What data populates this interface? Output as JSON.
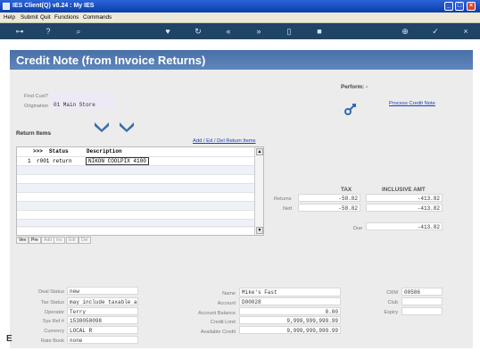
{
  "window": {
    "title": "IES Client(Q) v8.24 : My IES"
  },
  "menu": [
    "Help",
    "Submit",
    "Quit",
    "Functions",
    "Commands"
  ],
  "toolbar_icons": [
    "key-icon",
    "help-icon",
    "search-icon",
    "heart-icon",
    "refresh-icon",
    "rewind-icon",
    "forward-icon",
    "save-icon",
    "stop-icon",
    "plus-icon",
    "check-icon",
    "close-icon"
  ],
  "page": {
    "title": "Credit Note (from Invoice Returns)"
  },
  "find_cust": {
    "label": "Find Cust?",
    "value": ""
  },
  "origination": {
    "label": "Origination",
    "value": "01 Main Store"
  },
  "perform": {
    "label": "Perform: -",
    "link": "Process Credit Note"
  },
  "return_items": {
    "label": "Return Items",
    "link": "Add / Ed / Del Return Items",
    "columns": [
      ">>>",
      "Status",
      "Description"
    ],
    "rows": [
      {
        "num": "1",
        "status": "r001 return",
        "desc": "NIKON COOLPIX 4100"
      }
    ],
    "buttons": [
      "Vev",
      "Pre",
      "Add",
      "Ins",
      "Edt",
      "Del"
    ]
  },
  "totals": {
    "headers": [
      "TAX",
      "INCLUSIVE AMT"
    ],
    "returns": {
      "label": "Returns",
      "tax": "-58.82",
      "amt": "-413.82"
    },
    "nett": {
      "label": "Nett",
      "tax": "-58.82",
      "amt": "-413.82"
    },
    "due": {
      "label": "Due",
      "amt": "-413.82"
    }
  },
  "footer_left": [
    {
      "label": "Deal Status",
      "value": "new"
    },
    {
      "label": "Tax Status",
      "value": "may include taxable a"
    },
    {
      "label": "Operator",
      "value": "Terry"
    },
    {
      "label": "Sys Ref #",
      "value": "1538058098"
    },
    {
      "label": "Currency",
      "value": "LOCAL R"
    },
    {
      "label": "Rate Book",
      "value": "none"
    }
  ],
  "footer_mid": [
    {
      "label": "Name",
      "value": "Mike's Fast"
    },
    {
      "label": "Account",
      "value": "D00028"
    },
    {
      "label": "Account Balance",
      "value": "0.00"
    },
    {
      "label": "Credit Limit",
      "value": "9,999,999,999.99"
    },
    {
      "label": "Available Credit",
      "value": "9,999,999,999.99"
    }
  ],
  "footer_right": [
    {
      "label": "CRM",
      "value": "00586"
    },
    {
      "label": "Club",
      "value": ""
    },
    {
      "label": "Expiry",
      "value": ""
    }
  ]
}
